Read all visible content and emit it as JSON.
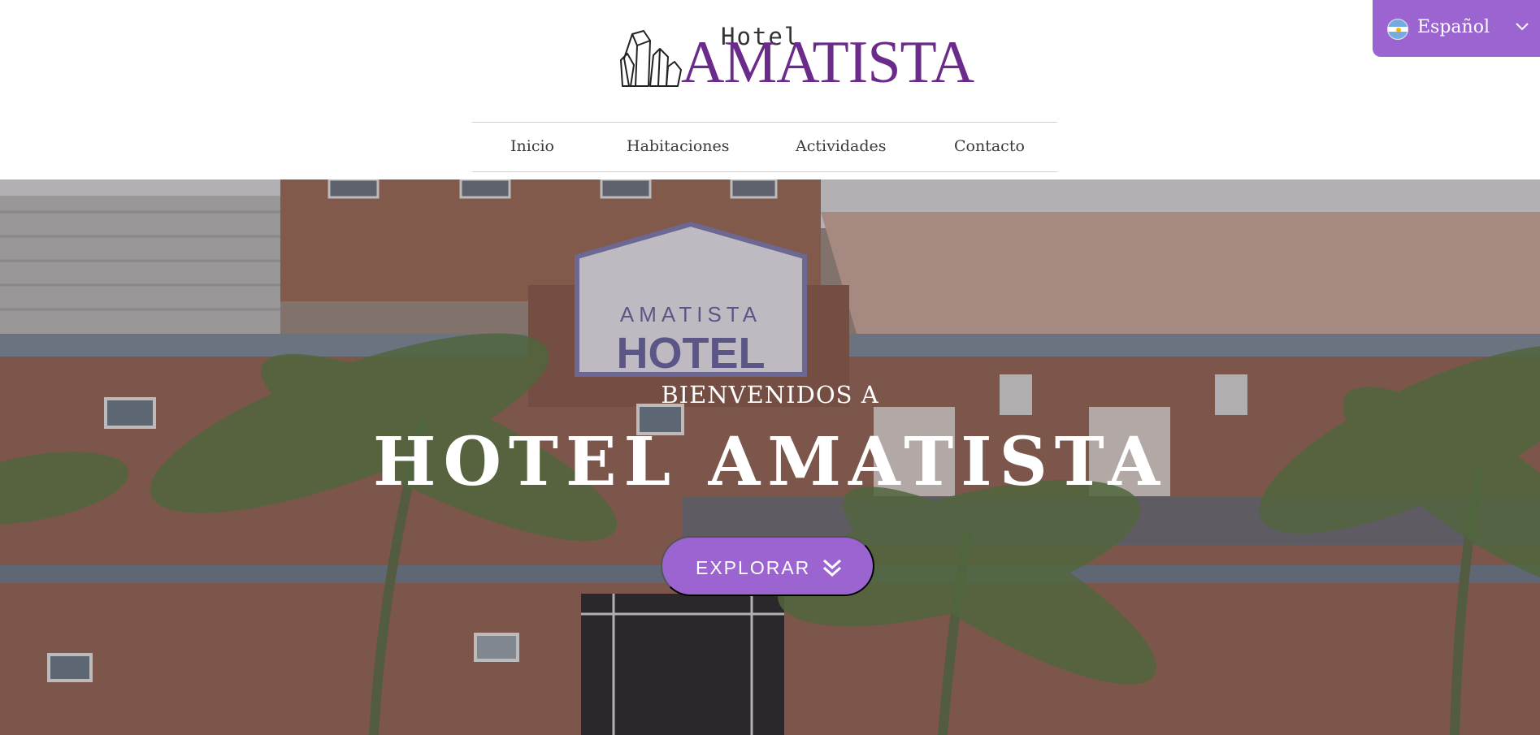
{
  "header": {
    "logo": {
      "word_small": "Hotel",
      "word_large": "AMATISTA"
    },
    "nav": [
      {
        "label": "Inicio"
      },
      {
        "label": "Habitaciones"
      },
      {
        "label": "Actividades"
      },
      {
        "label": "Contacto"
      }
    ]
  },
  "language_selector": {
    "label": "Español",
    "flag_icon": "argentina-flag-icon",
    "chevron_icon": "chevron-down-icon"
  },
  "hero": {
    "welcome": "BIENVENIDOS A",
    "title": "HOTEL AMATISTA",
    "sign_top": "AMATISTA",
    "sign_bottom": "HOTEL",
    "cta": {
      "label": "EXPLORAR",
      "icon": "double-chevron-down-icon"
    }
  },
  "colors": {
    "accent": "#9b64d0",
    "logo": "#6b2b8a"
  }
}
